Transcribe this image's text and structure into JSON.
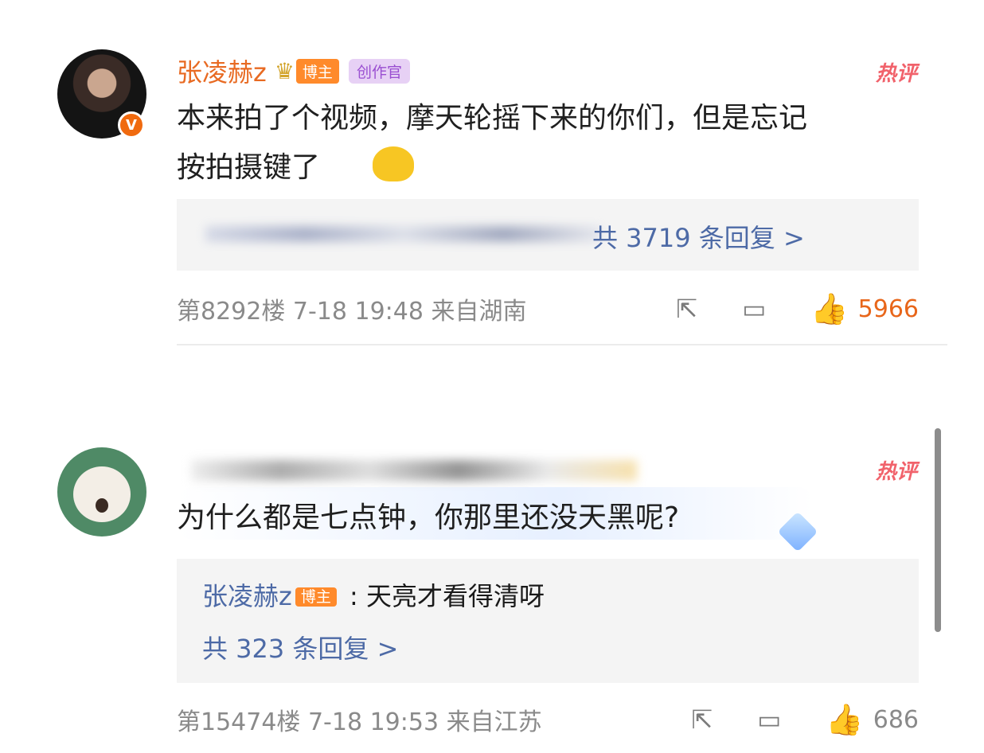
{
  "comments": [
    {
      "username": "张凌赫z",
      "tags": {
        "blogger": "博主",
        "creator": "创作官"
      },
      "hot_label": "热评",
      "text_line1": "本来拍了个视频，摩天轮摇下来的你们，但是忘记",
      "text_line2": "按拍摄键了",
      "reply_summary": "共 3719 条回复 >",
      "floor_time_location": "第8292楼 7-18 19:48 来自湖南",
      "like_count": "5966",
      "like_color": "#ff7a1a",
      "verified_badge": "V"
    },
    {
      "hot_label": "热评",
      "text": "为什么都是七点钟，你那里还没天黑呢?",
      "reply": {
        "username": "张凌赫z",
        "tag": "博主",
        "separator": " : ",
        "text": "天亮才看得清呀"
      },
      "reply_summary": "共 323 条回复 >",
      "floor_time_location": "第15474楼 7-18 19:53 来自江苏",
      "like_count": "686"
    }
  ],
  "icons": {
    "share": "share-icon",
    "comment": "comment-icon",
    "like": "thumbs-up-icon"
  }
}
